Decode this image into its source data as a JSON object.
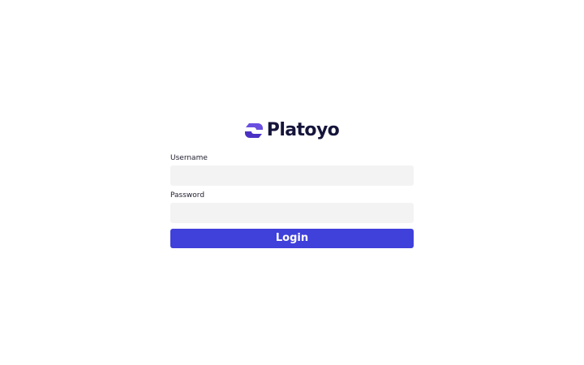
{
  "brand": {
    "name": "Platoyo",
    "logo_icon": "platoyo-logo-mark",
    "color_mark": "#5a3fd4",
    "color_text": "#15143a"
  },
  "form": {
    "username_label": "Username",
    "username_value": "",
    "password_label": "Password",
    "password_value": "",
    "login_label": "Login",
    "button_color": "#4040db",
    "input_bg": "#f3f3f4"
  }
}
